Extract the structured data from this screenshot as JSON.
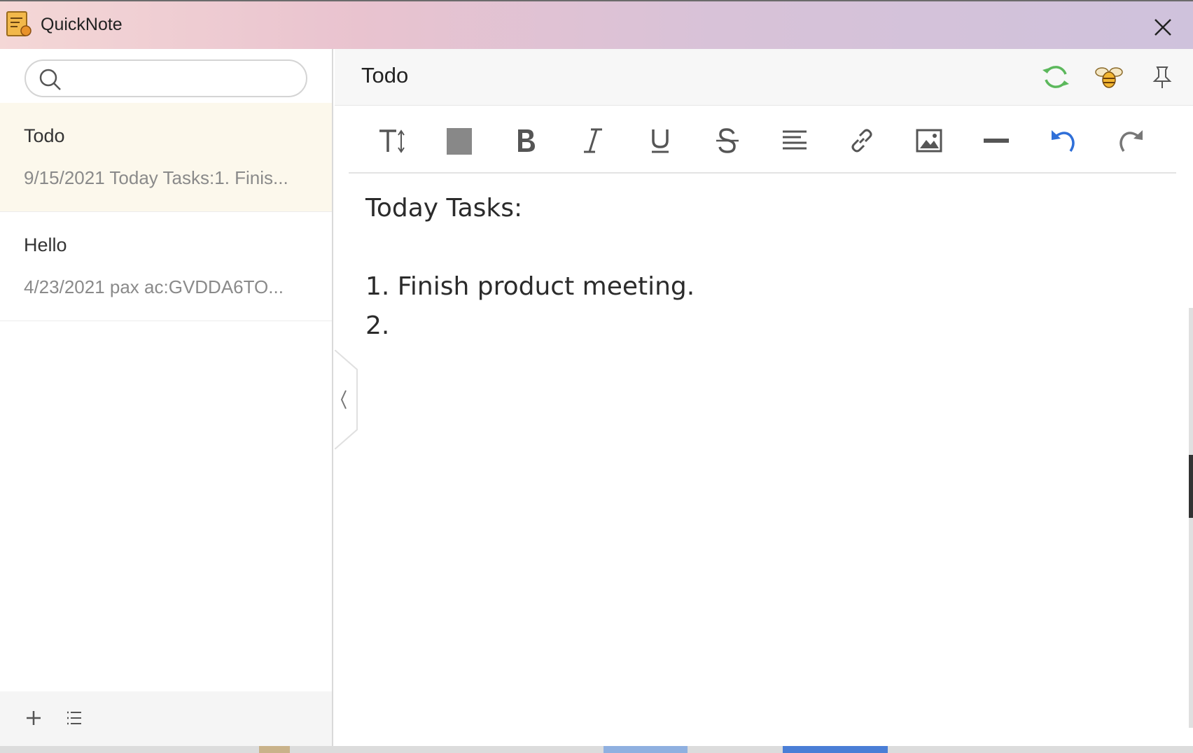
{
  "window": {
    "title": "QuickNote",
    "app_icon": "notepad-icon",
    "close_icon": "close-icon"
  },
  "sidebar": {
    "search": {
      "placeholder": "",
      "value": "",
      "icon": "search-icon"
    },
    "notes": [
      {
        "title": "Todo",
        "preview": "9/15/2021 Today Tasks:1. Finis...",
        "active": true
      },
      {
        "title": "Hello",
        "preview": "4/23/2021 pax ac:GVDDA6TO...",
        "active": false
      }
    ],
    "footer": {
      "add_icon": "plus-icon",
      "menu_icon": "list-icon"
    }
  },
  "editor": {
    "title": "Todo",
    "header_icons": [
      "sync-icon",
      "bee-icon",
      "pin-icon"
    ],
    "toolbar": [
      "text-size-icon",
      "color-block-icon",
      "bold-icon",
      "italic-icon",
      "underline-icon",
      "strikethrough-icon",
      "align-icon",
      "link-icon",
      "image-icon",
      "divider-icon",
      "undo-icon",
      "redo-icon"
    ],
    "content": [
      "Today Tasks:",
      "",
      "1. Finish product meeting.",
      "2."
    ]
  },
  "colors": {
    "sync": "#5cb85c",
    "undo": "#2f6fd8",
    "accent_active": "#fcf8ec"
  }
}
